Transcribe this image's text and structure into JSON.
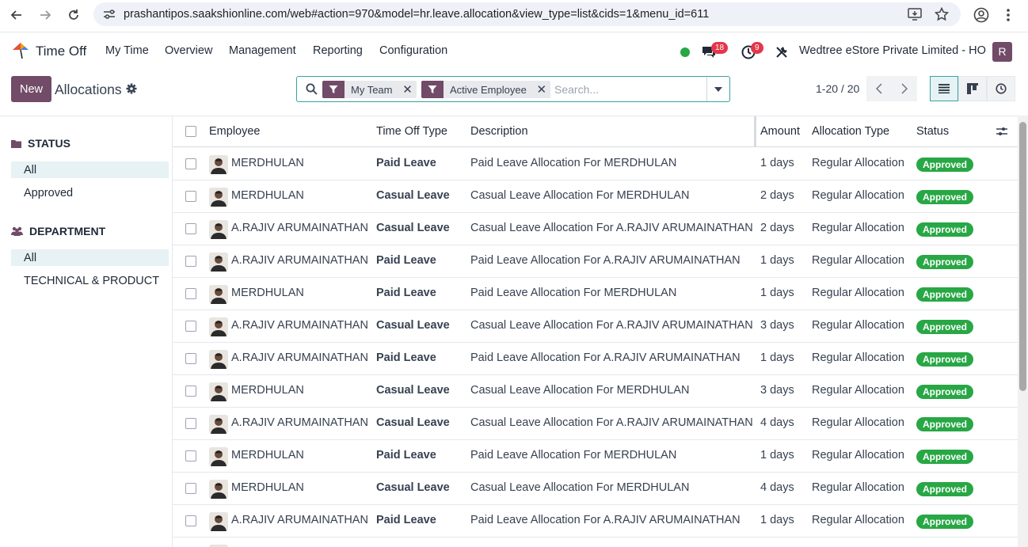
{
  "browser": {
    "url": "prashantipos.saakshionline.com/web#action=970&model=hr.leave.allocation&view_type=list&cids=1&menu_id=611"
  },
  "app_nav": {
    "app_name": "Time Off",
    "menu": [
      "My Time",
      "Overview",
      "Management",
      "Reporting",
      "Configuration"
    ],
    "messages_count": "18",
    "activities_count": "9",
    "company": "Wedtree eStore Private Limited - HO",
    "user_initial": "R",
    "status_color": "#28a745",
    "brand_color": "#714b67"
  },
  "control": {
    "new_label": "New",
    "title": "Allocations",
    "facets": [
      "My Team",
      "Active Employee"
    ],
    "search_placeholder": "Search...",
    "pager": "1-20 / 20"
  },
  "side_panel": {
    "status_title": "STATUS",
    "status_items": [
      "All",
      "Approved"
    ],
    "department_title": "DEPARTMENT",
    "department_items": [
      "All",
      "TECHNICAL & PRODUCT"
    ]
  },
  "table": {
    "headers": [
      "Employee",
      "Time Off Type",
      "Description",
      "Amount",
      "Allocation Type",
      "Status"
    ],
    "rows": [
      {
        "employee": "MERDHULAN",
        "type": "Paid Leave",
        "description": "Paid Leave Allocation For MERDHULAN",
        "amount": "1 days",
        "allocation_type": "Regular Allocation",
        "status": "Approved"
      },
      {
        "employee": "MERDHULAN",
        "type": "Casual Leave",
        "description": "Casual Leave Allocation For MERDHULAN",
        "amount": "2 days",
        "allocation_type": "Regular Allocation",
        "status": "Approved"
      },
      {
        "employee": "A.RAJIV ARUMAINATHAN",
        "type": "Casual Leave",
        "description": "Casual Leave Allocation For A.RAJIV ARUMAINATHAN",
        "amount": "2 days",
        "allocation_type": "Regular Allocation",
        "status": "Approved"
      },
      {
        "employee": "A.RAJIV ARUMAINATHAN",
        "type": "Paid Leave",
        "description": "Paid Leave Allocation For A.RAJIV ARUMAINATHAN",
        "amount": "1 days",
        "allocation_type": "Regular Allocation",
        "status": "Approved"
      },
      {
        "employee": "MERDHULAN",
        "type": "Paid Leave",
        "description": "Paid Leave Allocation For MERDHULAN",
        "amount": "1 days",
        "allocation_type": "Regular Allocation",
        "status": "Approved"
      },
      {
        "employee": "A.RAJIV ARUMAINATHAN",
        "type": "Casual Leave",
        "description": "Casual Leave Allocation For A.RAJIV ARUMAINATHAN",
        "amount": "3 days",
        "allocation_type": "Regular Allocation",
        "status": "Approved"
      },
      {
        "employee": "A.RAJIV ARUMAINATHAN",
        "type": "Paid Leave",
        "description": "Paid Leave Allocation For A.RAJIV ARUMAINATHAN",
        "amount": "1 days",
        "allocation_type": "Regular Allocation",
        "status": "Approved"
      },
      {
        "employee": "MERDHULAN",
        "type": "Casual Leave",
        "description": "Casual Leave Allocation For MERDHULAN",
        "amount": "3 days",
        "allocation_type": "Regular Allocation",
        "status": "Approved"
      },
      {
        "employee": "A.RAJIV ARUMAINATHAN",
        "type": "Casual Leave",
        "description": "Casual Leave Allocation For A.RAJIV ARUMAINATHAN",
        "amount": "4 days",
        "allocation_type": "Regular Allocation",
        "status": "Approved"
      },
      {
        "employee": "MERDHULAN",
        "type": "Paid Leave",
        "description": "Paid Leave Allocation For MERDHULAN",
        "amount": "1 days",
        "allocation_type": "Regular Allocation",
        "status": "Approved"
      },
      {
        "employee": "MERDHULAN",
        "type": "Casual Leave",
        "description": "Casual Leave Allocation For MERDHULAN",
        "amount": "4 days",
        "allocation_type": "Regular Allocation",
        "status": "Approved"
      },
      {
        "employee": "A.RAJIV ARUMAINATHAN",
        "type": "Paid Leave",
        "description": "Paid Leave Allocation For A.RAJIV ARUMAINATHAN",
        "amount": "1 days",
        "allocation_type": "Regular Allocation",
        "status": "Approved"
      }
    ]
  }
}
